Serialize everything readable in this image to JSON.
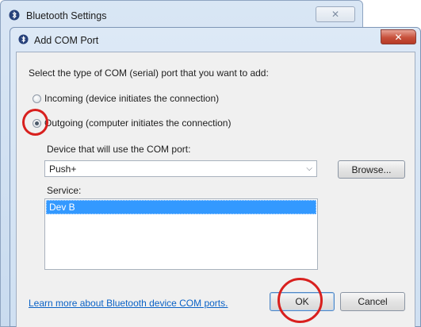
{
  "background_window": {
    "title": "Bluetooth Settings",
    "close_glyph": "✕",
    "icon": "bluetooth-icon"
  },
  "dialog": {
    "title": "Add COM Port",
    "close_glyph": "✕",
    "icon": "bluetooth-icon",
    "prompt": "Select the type of COM (serial) port that you want to add:",
    "options": [
      {
        "label": "Incoming (device initiates the connection)",
        "checked": false
      },
      {
        "label": "Outgoing (computer initiates the connection)",
        "checked": true
      }
    ],
    "device_label": "Device that will use the COM port:",
    "device_value": "Push+",
    "browse_label": "Browse...",
    "service_label": "Service:",
    "services": [
      "Dev B"
    ],
    "learn_more_link": "Learn more about Bluetooth device COM ports.",
    "ok_label": "OK",
    "cancel_label": "Cancel"
  },
  "colors": {
    "highlight_circle": "#d8201e",
    "selection": "#3399ff",
    "link": "#0a62c6"
  }
}
